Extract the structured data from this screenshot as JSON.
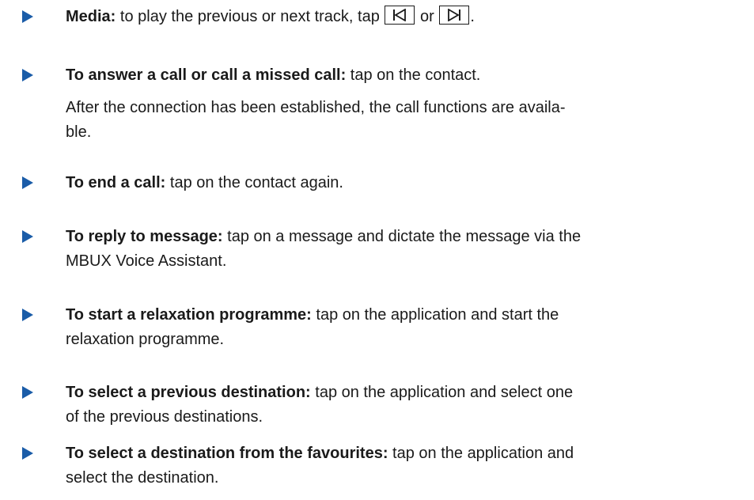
{
  "items": [
    {
      "label": "Media:",
      "text_a": " to play the previous or next track, tap ",
      "text_or": " or ",
      "text_end": ".",
      "icon_prev": "skip-previous-icon",
      "icon_next": "skip-next-icon"
    },
    {
      "label": "To answer a call or call a missed call:",
      "text": " tap on the contact.",
      "note_line1": "After the connection has been established, the call functions are availa-",
      "note_line2": "ble."
    },
    {
      "label": "To end a call:",
      "text": " tap on the contact again."
    },
    {
      "label": "To reply to message:",
      "text_line1": " tap on a message and dictate the message via the",
      "text_line2": "MBUX Voice Assistant."
    },
    {
      "label": "To start a relaxation programme:",
      "text_line1": " tap on the application and start the",
      "text_line2": "relaxation programme."
    },
    {
      "label": "To select a previous destination:",
      "text_line1": " tap on the application and select one",
      "text_line2": "of the previous destinations."
    },
    {
      "label": "To select a destination from the favourites:",
      "text_line1": " tap on the application and",
      "text_line2": "select the destination."
    }
  ],
  "colors": {
    "bullet": "#1a5ca8",
    "text": "#1a1a1a"
  }
}
